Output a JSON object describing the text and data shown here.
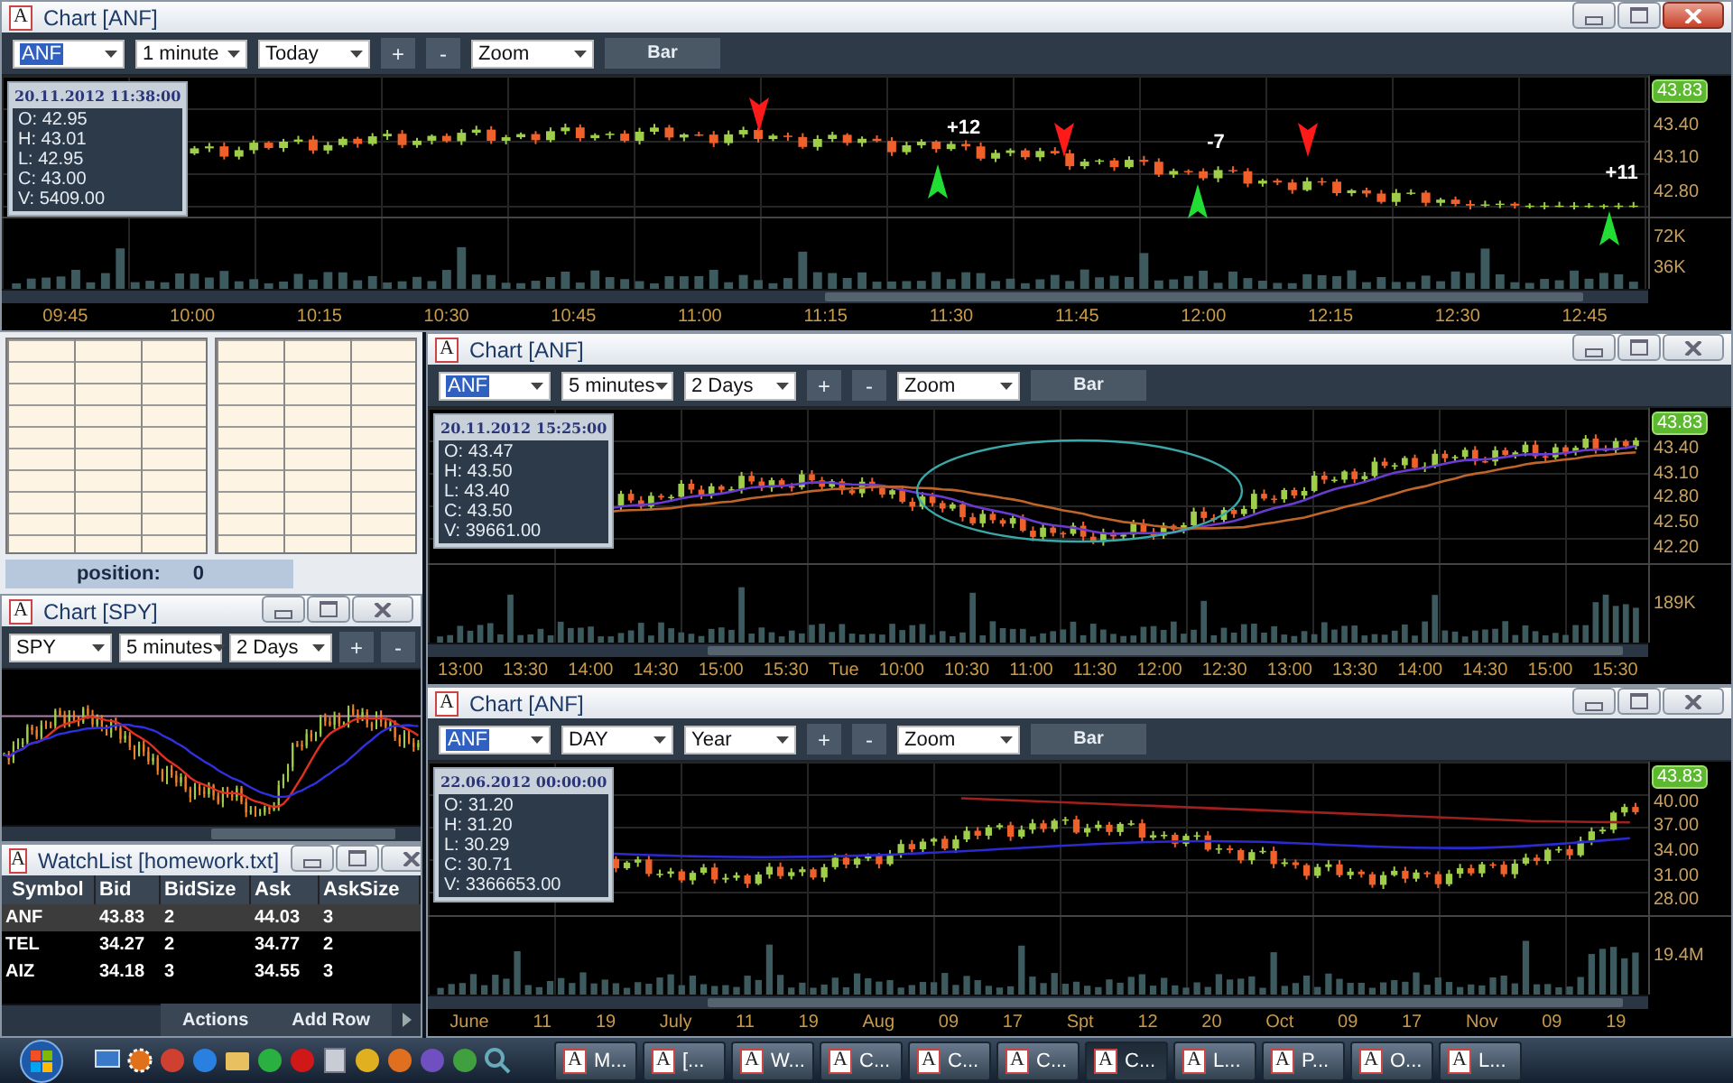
{
  "top_chart": {
    "app_icon": "A",
    "title": "Chart [ANF]",
    "active": true,
    "toolbar": {
      "symbol": "ANF",
      "interval": "1 minute",
      "range": "Today",
      "plus": "+",
      "minus": "-",
      "zoom": "Zoom",
      "chart_type": "Bar"
    },
    "info": {
      "datetime": "20.11.2012 11:38:00",
      "lines": [
        "O: 42.95",
        "H: 43.01",
        "L: 42.95",
        "C: 43.00",
        "V: 5409.00"
      ]
    },
    "last_price": "43.83",
    "price_ticks": [
      "43.40",
      "43.10",
      "42.80"
    ],
    "volume_ticks": [
      "72K",
      "36K"
    ],
    "time_ticks": [
      "09:45",
      "10:00",
      "10:15",
      "10:30",
      "10:45",
      "11:00",
      "11:15",
      "11:30",
      "11:45",
      "12:00",
      "12:15",
      "12:30",
      "12:45"
    ],
    "signals": [
      {
        "kind": "sell"
      },
      {
        "kind": "buy",
        "label": "+12"
      },
      {
        "kind": "sell"
      },
      {
        "kind": "buy",
        "label": "-7"
      },
      {
        "kind": "sell"
      },
      {
        "kind": "buy",
        "label": "+11"
      }
    ]
  },
  "middle_chart": {
    "app_icon": "A",
    "title": "Chart [ANF]",
    "active": false,
    "toolbar": {
      "symbol": "ANF",
      "interval": "5 minutes",
      "range": "2 Days",
      "plus": "+",
      "minus": "-",
      "zoom": "Zoom",
      "chart_type": "Bar"
    },
    "info": {
      "datetime": "20.11.2012 15:25:00",
      "lines": [
        "O: 43.47",
        "H: 43.50",
        "L: 43.40",
        "C: 43.50",
        "V: 39661.00"
      ]
    },
    "last_price": "43.83",
    "price_ticks": [
      "43.40",
      "43.10",
      "42.80",
      "42.50",
      "42.20"
    ],
    "volume_ticks": [
      "189K"
    ],
    "time_ticks": [
      "13:00",
      "13:30",
      "14:00",
      "14:30",
      "15:00",
      "15:30",
      "Tue",
      "10:00",
      "10:30",
      "11:00",
      "11:30",
      "12:00",
      "12:30",
      "13:00",
      "13:30",
      "14:00",
      "14:30",
      "15:00",
      "15:30"
    ],
    "markers": [
      {
        "kind": "ellipse"
      }
    ]
  },
  "bottom_chart": {
    "app_icon": "A",
    "title": "Chart [ANF]",
    "active": false,
    "toolbar": {
      "symbol": "ANF",
      "interval": "DAY",
      "range": "Year",
      "plus": "+",
      "minus": "-",
      "zoom": "Zoom",
      "chart_type": "Bar"
    },
    "info": {
      "datetime": "22.06.2012 00:00:00",
      "lines": [
        "O: 31.20",
        "H: 31.20",
        "L: 30.29",
        "C: 30.71",
        "V: 3366653.00"
      ]
    },
    "last_price": "43.83",
    "price_ticks": [
      "40.00",
      "37.00",
      "34.00",
      "31.00",
      "28.00"
    ],
    "volume_ticks": [
      "19.4M"
    ],
    "time_ticks": [
      "June",
      "11",
      "19",
      "July",
      "11",
      "19",
      "Aug",
      "09",
      "17",
      "Spt",
      "12",
      "20",
      "Oct",
      "09",
      "17",
      "Nov",
      "09",
      "19"
    ]
  },
  "positions": {
    "label": "position:",
    "value": "0"
  },
  "spy_chart": {
    "app_icon": "A",
    "title": "Chart [SPY]",
    "active": false,
    "toolbar": {
      "symbol": "SPY",
      "interval": "5 minutes",
      "range": "2 Days",
      "plus": "+",
      "minus": "-"
    }
  },
  "watchlist": {
    "app_icon": "A",
    "title": "WatchList [homework.txt]",
    "active": false,
    "columns": [
      "Symbol",
      "Bid",
      "BidSize",
      "Ask",
      "AskSize"
    ],
    "rows": [
      {
        "cells": [
          "ANF",
          "43.83",
          "2",
          "44.03",
          "3"
        ],
        "selected": true
      },
      {
        "cells": [
          "TEL",
          "34.27",
          "2",
          "34.77",
          "2"
        ],
        "selected": false
      },
      {
        "cells": [
          "AIZ",
          "34.18",
          "3",
          "34.55",
          "3"
        ],
        "selected": false
      }
    ],
    "actions": [
      "Actions",
      "Add Row"
    ]
  },
  "taskbar": {
    "tasks": [
      {
        "app_icon": "A",
        "label": "M...",
        "selected": false
      },
      {
        "app_icon": "A",
        "label": "[...",
        "selected": false
      },
      {
        "app_icon": "A",
        "label": "W...",
        "selected": false
      },
      {
        "app_icon": "A",
        "label": "C...",
        "selected": false
      },
      {
        "app_icon": "A",
        "label": "C...",
        "selected": false
      },
      {
        "app_icon": "A",
        "label": "C...",
        "selected": false
      },
      {
        "app_icon": "A",
        "label": "C...",
        "selected": true
      },
      {
        "app_icon": "A",
        "label": "L...",
        "selected": false
      },
      {
        "app_icon": "A",
        "label": "P...",
        "selected": false
      },
      {
        "app_icon": "A",
        "label": "O...",
        "selected": false
      },
      {
        "app_icon": "A",
        "label": "L...",
        "selected": false
      }
    ]
  }
}
